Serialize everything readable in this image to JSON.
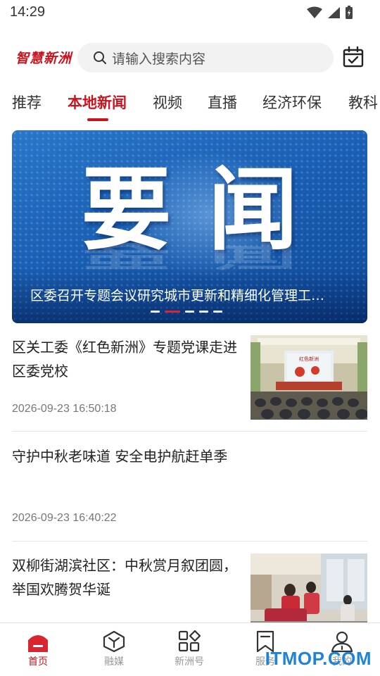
{
  "status_bar": {
    "time": "14:29"
  },
  "header": {
    "logo": "智慧新洲",
    "search_placeholder": "请输入搜索内容"
  },
  "tabs": [
    "推荐",
    "本地新闻",
    "视频",
    "直播",
    "经济环保",
    "教科"
  ],
  "active_tab_index": 1,
  "banner": {
    "big_text": "要闻",
    "caption": "区委召开专题会议研究城市更新和精细化管理工…",
    "slide_count": 5,
    "active_slide": 1
  },
  "news": [
    {
      "title": "区关工委《红色新洲》专题党课走进区委党校",
      "time": "2026-09-23 16:50:18",
      "thumb_screen_text": "红色新洲"
    },
    {
      "title": "守护中秋老味道 安全电护航赶单季",
      "time": "2026-09-23 16:40:22"
    },
    {
      "title": "双柳街湖滨社区：中秋赏月叙团圆，举国欢腾贺华诞"
    }
  ],
  "bottom_nav": [
    {
      "label": "首页",
      "icon": "home-icon",
      "active": true
    },
    {
      "label": "融媒",
      "icon": "media-cube-icon",
      "active": false
    },
    {
      "label": "新洲号",
      "icon": "grid-apps-icon",
      "active": false
    },
    {
      "label": "服务",
      "icon": "bookmark-icon",
      "active": false
    },
    {
      "label": "我的",
      "icon": "user-icon",
      "active": false
    }
  ],
  "watermark": "ITMOP.COM",
  "colors": {
    "accent": "#c9141f",
    "banner_blue": "#1a5fb3",
    "watermark_blue": "#1e84d6"
  }
}
